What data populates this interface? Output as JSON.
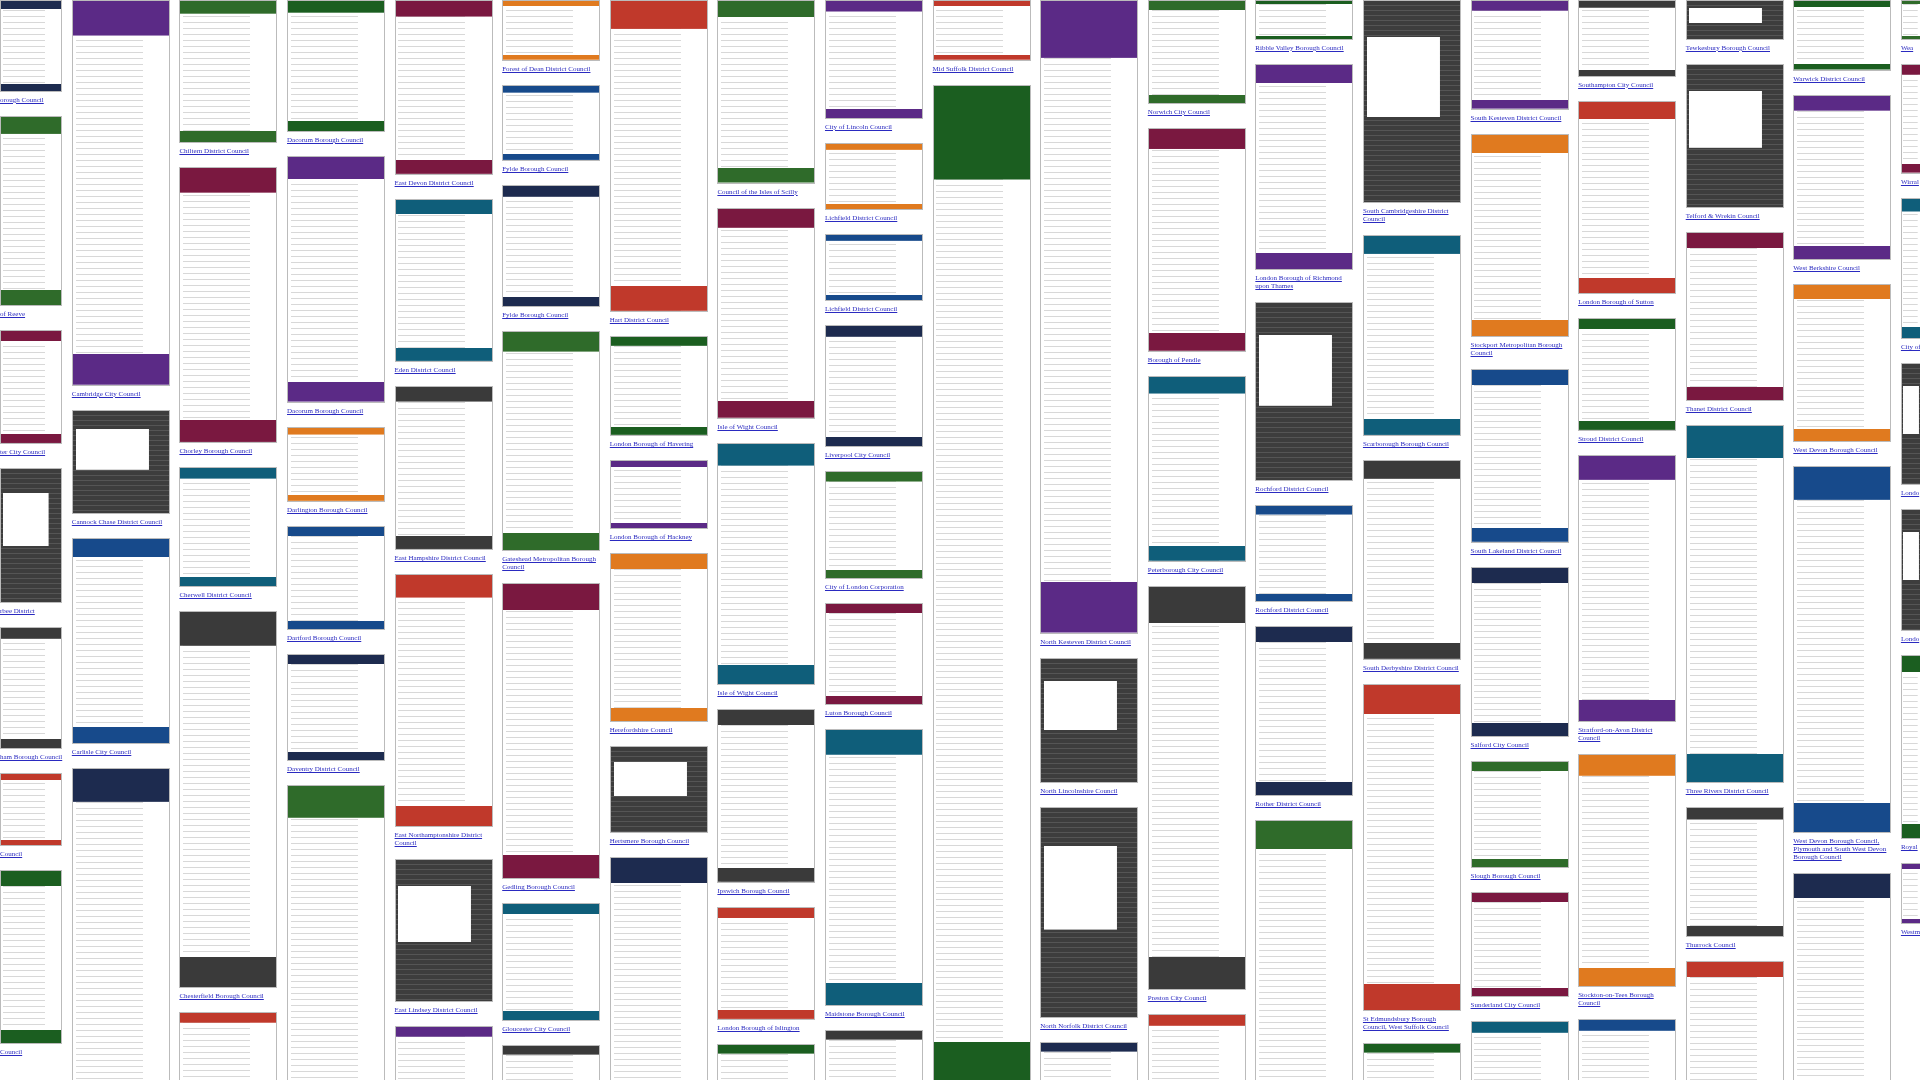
{
  "columns": [
    {
      "cards": [
        {
          "kind": "light",
          "caption": "orough Council"
        },
        {
          "kind": "light",
          "caption": "of Reeve"
        },
        {
          "kind": "light",
          "caption": "ter City Council"
        },
        {
          "kind": "dark",
          "caption": "rbee District"
        },
        {
          "kind": "light",
          "caption": "ham Borough Council"
        },
        {
          "kind": "light",
          "caption": "Council"
        },
        {
          "kind": "light",
          "caption": "Council"
        }
      ]
    },
    {
      "cards": [
        {
          "kind": "light",
          "caption": "Cambridge City Council"
        },
        {
          "kind": "dark",
          "caption": "Cannock Chase District Council"
        },
        {
          "kind": "light",
          "caption": "Carlisle City Council"
        },
        {
          "kind": "light"
        }
      ]
    },
    {
      "cards": [
        {
          "kind": "light",
          "caption": "Chiltern District Council"
        },
        {
          "kind": "light",
          "caption": "Chorley Borough Council"
        },
        {
          "kind": "light",
          "caption": "Cherwell District Council"
        },
        {
          "kind": "light",
          "caption": "Chesterfield Borough Council"
        },
        {
          "kind": "light"
        }
      ]
    },
    {
      "cards": [
        {
          "kind": "light",
          "caption": "Dacorum Borough Council"
        },
        {
          "kind": "light",
          "caption": "Dacorum Borough Council"
        },
        {
          "kind": "light",
          "caption": "Darlington Borough Council"
        },
        {
          "kind": "light",
          "caption": "Dartford Borough Council"
        },
        {
          "kind": "light",
          "caption": "Daventry District Council"
        },
        {
          "kind": "light"
        }
      ]
    },
    {
      "cards": [
        {
          "kind": "light",
          "caption": "East Devon District Council"
        },
        {
          "kind": "light",
          "caption": "Eden District Council"
        },
        {
          "kind": "light",
          "caption": "East Hampshire District Council"
        },
        {
          "kind": "light",
          "caption": "East Northamptonshire District Council"
        },
        {
          "kind": "dark",
          "caption": "East Lindsey District Council"
        },
        {
          "kind": "light"
        }
      ]
    },
    {
      "cards": [
        {
          "kind": "light",
          "caption": "Forest of Dean District Council"
        },
        {
          "kind": "light",
          "caption": "Fylde Borough Council"
        },
        {
          "kind": "light",
          "caption": "Fylde Borough Council"
        },
        {
          "kind": "light",
          "caption": "Gateshead Metropolitan Borough Council"
        },
        {
          "kind": "light",
          "caption": "Gedling Borough Council"
        },
        {
          "kind": "light",
          "caption": "Gloucester City Council"
        },
        {
          "kind": "light"
        }
      ]
    },
    {
      "cards": [
        {
          "kind": "light",
          "caption": "Hart District Council"
        },
        {
          "kind": "light",
          "caption": "London Borough of Havering"
        },
        {
          "kind": "light",
          "caption": "London Borough of Hackney"
        },
        {
          "kind": "light",
          "caption": "Herefordshire Council"
        },
        {
          "kind": "dark",
          "caption": "Hertsmere Borough Council"
        },
        {
          "kind": "light"
        }
      ]
    },
    {
      "cards": [
        {
          "kind": "light",
          "caption": "Council of the Isles of Scilly"
        },
        {
          "kind": "light",
          "caption": "Isle of Wight Council"
        },
        {
          "kind": "light",
          "caption": "Isle of Wight Council"
        },
        {
          "kind": "light",
          "caption": "Ipswich Borough Council"
        },
        {
          "kind": "light",
          "caption": "London Borough of Islington"
        },
        {
          "kind": "light"
        }
      ]
    },
    {
      "cards": [
        {
          "kind": "light",
          "caption": "City of Lincoln Council"
        },
        {
          "kind": "light",
          "caption": "Lichfield District Council"
        },
        {
          "kind": "light",
          "caption": "Lichfield District Council"
        },
        {
          "kind": "light",
          "caption": "Liverpool City Council"
        },
        {
          "kind": "light",
          "caption": "City of London Corporation"
        },
        {
          "kind": "light",
          "caption": "Luton Borough Council"
        },
        {
          "kind": "light",
          "caption": "Maidstone Borough Council"
        },
        {
          "kind": "light"
        }
      ]
    },
    {
      "cards": [
        {
          "kind": "light",
          "caption": "Mid Suffolk District Council"
        },
        {
          "kind": "light"
        }
      ]
    },
    {
      "cards": [
        {
          "kind": "light",
          "caption": "North Kesteven District Council"
        },
        {
          "kind": "dark",
          "caption": "North Lincolnshire Council"
        },
        {
          "kind": "dark",
          "caption": "North Norfolk District Council"
        },
        {
          "kind": "light"
        }
      ]
    },
    {
      "cards": [
        {
          "kind": "light",
          "caption": "Norwich City Council"
        },
        {
          "kind": "light",
          "caption": "Borough of Pendle"
        },
        {
          "kind": "light",
          "caption": "Peterborough City Council"
        },
        {
          "kind": "light",
          "caption": "Preston City Council"
        },
        {
          "kind": "light"
        }
      ]
    },
    {
      "cards": [
        {
          "kind": "light",
          "caption": "Ribble Valley Borough Council"
        },
        {
          "kind": "light",
          "caption": "London Borough of Richmond upon Thames"
        },
        {
          "kind": "dark",
          "caption": "Rochford District Council"
        },
        {
          "kind": "light",
          "caption": "Rochford District Council"
        },
        {
          "kind": "light",
          "caption": "Rother District Council"
        },
        {
          "kind": "light"
        }
      ]
    },
    {
      "cards": [
        {
          "kind": "dark",
          "caption": "South Cambridgeshire District Council"
        },
        {
          "kind": "light",
          "caption": "Scarborough Borough Council"
        },
        {
          "kind": "light",
          "caption": "South Derbyshire District Council"
        },
        {
          "kind": "light",
          "caption": "St Edmundsbury Borough Council, West Suffolk Council"
        },
        {
          "kind": "light"
        }
      ]
    },
    {
      "cards": [
        {
          "kind": "light",
          "caption": "South Kesteven District Council"
        },
        {
          "kind": "light",
          "caption": "Stockport Metropolitan Borough Council"
        },
        {
          "kind": "light",
          "caption": "South Lakeland District Council"
        },
        {
          "kind": "light",
          "caption": "Salford City Council"
        },
        {
          "kind": "light",
          "caption": "Slough Borough Council"
        },
        {
          "kind": "light",
          "caption": "Sunderland City Council"
        },
        {
          "kind": "light"
        }
      ]
    },
    {
      "cards": [
        {
          "kind": "light",
          "caption": "Southampton City Council"
        },
        {
          "kind": "light",
          "caption": "London Borough of Sutton"
        },
        {
          "kind": "light",
          "caption": "Stroud District Council"
        },
        {
          "kind": "light",
          "caption": "Stratford-on-Avon District Council"
        },
        {
          "kind": "light",
          "caption": "Stockton-on-Tees Borough Council"
        },
        {
          "kind": "light"
        }
      ]
    },
    {
      "cards": [
        {
          "kind": "dark",
          "caption": "Tewkesbury Borough Council"
        },
        {
          "kind": "dark",
          "caption": "Telford & Wrekin Council"
        },
        {
          "kind": "light",
          "caption": "Thanet District Council"
        },
        {
          "kind": "light",
          "caption": "Three Rivers District Council"
        },
        {
          "kind": "light",
          "caption": "Thurrock Council"
        },
        {
          "kind": "light"
        }
      ]
    },
    {
      "cards": [
        {
          "kind": "light",
          "caption": "Warwick District Council"
        },
        {
          "kind": "light",
          "caption": "West Berkshire Council"
        },
        {
          "kind": "light",
          "caption": "West Devon Borough Council"
        },
        {
          "kind": "light",
          "caption": "West Devon Borough Council, Plymouth and South West Devon Borough Council"
        },
        {
          "kind": "light"
        }
      ]
    },
    {
      "cards": [
        {
          "kind": "light",
          "caption": "Wea"
        },
        {
          "kind": "light",
          "caption": "Wirral"
        },
        {
          "kind": "light",
          "caption": "City of"
        },
        {
          "kind": "dark",
          "caption": "Londo"
        },
        {
          "kind": "dark",
          "caption": "Londo"
        },
        {
          "kind": "light",
          "caption": "Royal"
        },
        {
          "kind": "light",
          "caption": "Westm"
        }
      ]
    }
  ]
}
